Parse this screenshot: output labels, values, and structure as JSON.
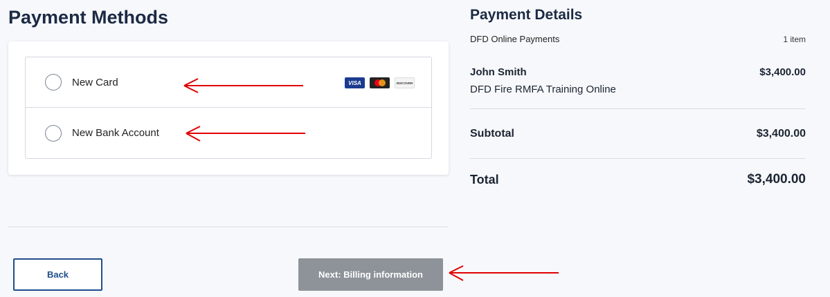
{
  "payment_methods": {
    "heading": "Payment Methods",
    "options": [
      {
        "label": "New Card",
        "selected": false,
        "card_logos": [
          "visa-logo",
          "mastercard-logo",
          "discover-logo"
        ]
      },
      {
        "label": "New Bank Account",
        "selected": false
      }
    ],
    "logo_text": {
      "visa": "VISA",
      "discover": "DISCOVER"
    }
  },
  "buttons": {
    "back_label": "Back",
    "next_label": "Next: Billing information"
  },
  "payment_details": {
    "title": "Payment Details",
    "merchant": "DFD Online Payments",
    "item_count": "1 item",
    "line_item": {
      "payer": "John Smith",
      "description": "DFD Fire RMFA Training Online",
      "amount": "$3,400.00"
    },
    "subtotal_label": "Subtotal",
    "subtotal_amount": "$3,400.00",
    "total_label": "Total",
    "total_amount": "$3,400.00"
  },
  "colors": {
    "accent": "#1f4e8c",
    "disabled_button": "#8e9399",
    "annotation_arrow": "#e00000"
  }
}
